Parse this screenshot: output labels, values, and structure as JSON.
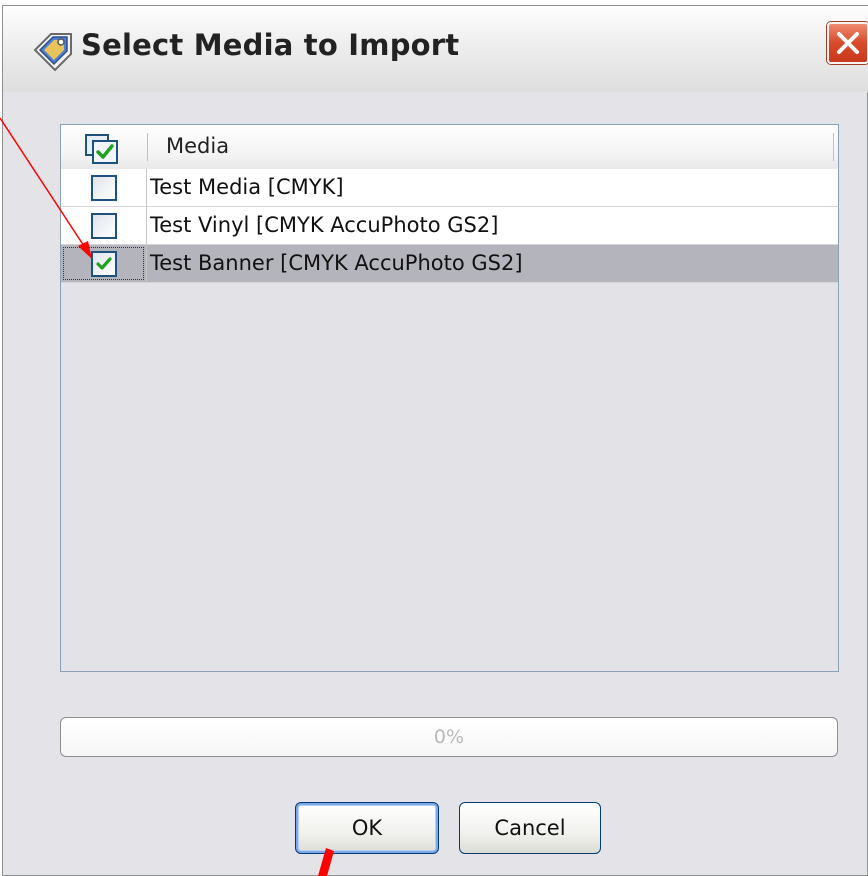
{
  "window": {
    "title": "Select Media to Import",
    "title_icon": "media-tag-icon",
    "close_icon": "close-icon"
  },
  "media_list": {
    "header": {
      "column_label": "Media",
      "select_all_checked": true
    },
    "rows": [
      {
        "label": "Test Media [CMYK]",
        "checked": false,
        "selected": false
      },
      {
        "label": "Test Vinyl [CMYK AccuPhoto GS2]",
        "checked": false,
        "selected": false
      },
      {
        "label": "Test Banner [CMYK AccuPhoto GS2]",
        "checked": true,
        "selected": true
      }
    ]
  },
  "progress": {
    "value": 0,
    "text": "0%"
  },
  "buttons": {
    "ok_label": "OK",
    "cancel_label": "Cancel"
  },
  "colors": {
    "annotation_arrow": "#ff0000",
    "checkmark": "#21a121",
    "title_close": "#d84a2a"
  }
}
